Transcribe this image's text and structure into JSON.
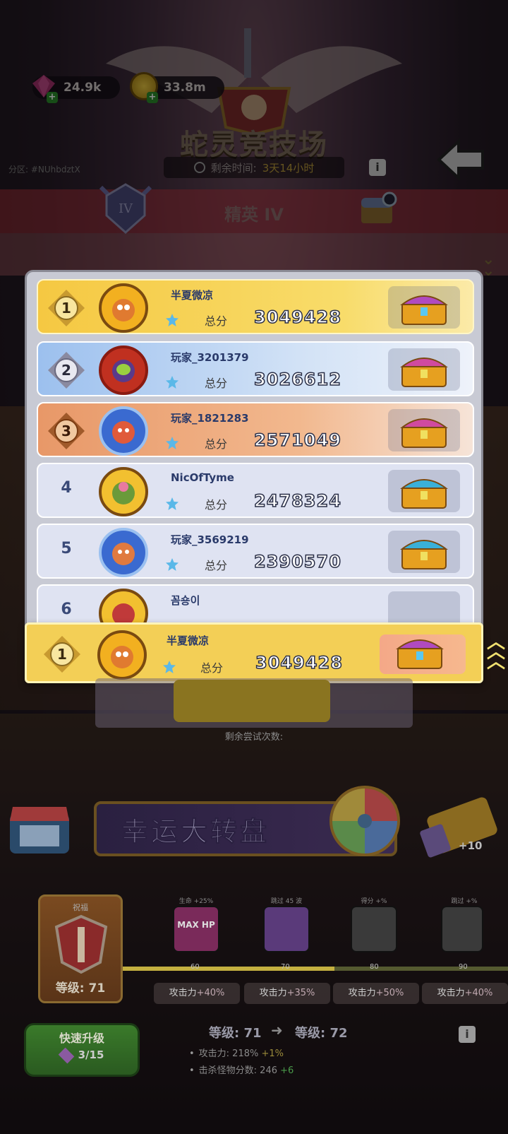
{
  "header": {
    "gems": "24.9k",
    "coins": "33.8m",
    "title": "蛇灵竞技场",
    "timer_label": "剩余时间:",
    "timer_value": "3天14小时",
    "region": "分区: #NUhbdztX",
    "tier": "精英 IV",
    "tier_badge": "IV",
    "info_glyph": "i",
    "icons": [
      "gem-icon",
      "coin-icon",
      "clock-icon",
      "info-icon",
      "back-arrow-icon",
      "tier-badge-icon",
      "chest-search-icon"
    ]
  },
  "leaderboard": {
    "score_label": "总分",
    "rows": [
      {
        "rank": "1",
        "name": "半夏微凉",
        "score": "3049428",
        "chest": "gold"
      },
      {
        "rank": "2",
        "name": "玩家_3201379",
        "score": "3026612",
        "chest": "pink"
      },
      {
        "rank": "3",
        "name": "玩家_1821283",
        "score": "2571049",
        "chest": "pink"
      },
      {
        "rank": "4",
        "name": "NicOfTyme",
        "score": "2478324",
        "chest": "blue"
      },
      {
        "rank": "5",
        "name": "玩家_3569219",
        "score": "2390570",
        "chest": "blue"
      },
      {
        "rank": "6",
        "name": "꼼숑이",
        "score": "",
        "chest": "blue"
      }
    ],
    "self": {
      "rank": "1",
      "name": "半夏微凉",
      "score": "3049428"
    }
  },
  "battle": {
    "attempts_label": "剩余尝试次数:"
  },
  "wheel": {
    "label": "幸运大转盘",
    "ticket_bonus": "+10"
  },
  "upgrade": {
    "blessing_label": "祝福",
    "level_label": "等级: 71",
    "skills": [
      {
        "top": "生命 +25%",
        "inner": "MAX HP"
      },
      {
        "top": "跳过 45 波",
        "inner": ""
      },
      {
        "top": "得分 +%",
        "inner": ""
      },
      {
        "top": "跳过 +%",
        "inner": ""
      }
    ],
    "ticks": [
      "60",
      "70",
      "80",
      "90"
    ],
    "progress": 0.55,
    "attack_pills": [
      {
        "label": "攻击力",
        "pct": "+40%"
      },
      {
        "label": "攻击力",
        "pct": "+35%"
      },
      {
        "label": "攻击力",
        "pct": "+50%"
      },
      {
        "label": "攻击力",
        "pct": "+40%"
      }
    ],
    "quick_label": "快速升级",
    "quick_cost": "3/15",
    "level_from": "等级: 71",
    "level_to": "等级: 72",
    "arrow": "➜",
    "attack_stat": "攻击力: 218%",
    "attack_inc": "+1%",
    "kill_stat": "击杀怪物分数: 246",
    "kill_inc": "+6"
  },
  "colors": {
    "rank1": "#f5c842",
    "rank2": "#9cc0ee",
    "rank3": "#e89868",
    "other": "#dfe3f2",
    "score_stroke": "#2a2f48"
  }
}
